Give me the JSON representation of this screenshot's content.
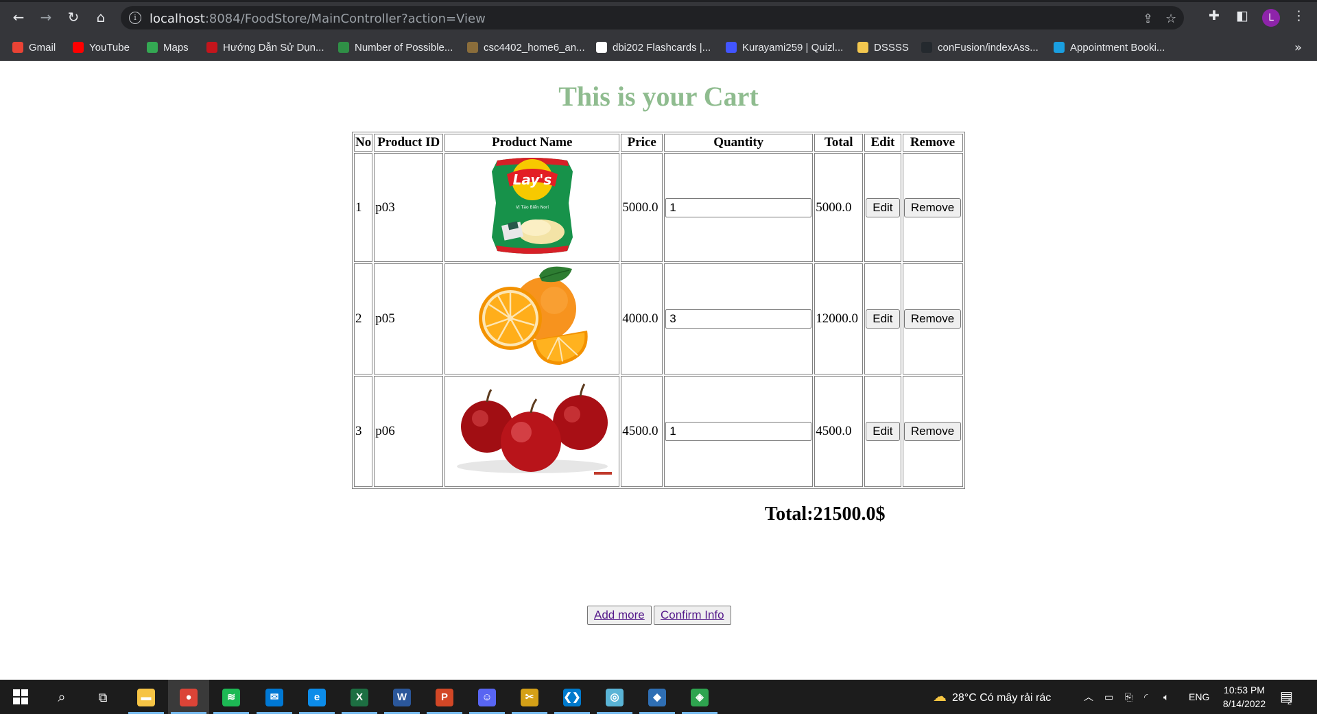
{
  "browser": {
    "url_host": "localhost",
    "url_path": ":8084/FoodStore/MainController?action=View",
    "profile_initial": "L",
    "bookmarks": [
      {
        "label": "Gmail",
        "icon": "gmail-icon",
        "color": "#ea4335"
      },
      {
        "label": "YouTube",
        "icon": "youtube-icon",
        "color": "#ff0000"
      },
      {
        "label": "Maps",
        "icon": "maps-icon",
        "color": "#34a853"
      },
      {
        "label": "Hướng Dẫn Sử Dụn...",
        "icon": "guide-icon",
        "color": "#c4151c"
      },
      {
        "label": "Number of Possible...",
        "icon": "math-icon",
        "color": "#2f8f46"
      },
      {
        "label": "csc4402_home6_an...",
        "icon": "file-icon",
        "color": "#8a6d3b"
      },
      {
        "label": "dbi202 Flashcards |...",
        "icon": "globe-icon",
        "color": "#ffffff"
      },
      {
        "label": "Kurayami259 | Quizl...",
        "icon": "quizlet-icon",
        "color": "#4255ff"
      },
      {
        "label": "DSSSS",
        "icon": "folder-icon",
        "color": "#f3c74f"
      },
      {
        "label": "conFusion/indexAss...",
        "icon": "github-icon",
        "color": "#24292e"
      },
      {
        "label": "Appointment Booki...",
        "icon": "booking-icon",
        "color": "#1a9fe0"
      }
    ]
  },
  "page": {
    "title": "This is your Cart",
    "headers": {
      "no": "No",
      "id": "Product ID",
      "name": "Product Name",
      "price": "Price",
      "quantity": "Quantity",
      "total": "Total",
      "edit": "Edit",
      "remove": "Remove"
    },
    "rows": [
      {
        "no": "1",
        "id": "p03",
        "image": "lays-chips-image",
        "price": "5000.0",
        "quantity": "1",
        "total": "5000.0",
        "edit_label": "Edit",
        "remove_label": "Remove"
      },
      {
        "no": "2",
        "id": "p05",
        "image": "orange-image",
        "price": "4000.0",
        "quantity": "3",
        "total": "12000.0",
        "edit_label": "Edit",
        "remove_label": "Remove"
      },
      {
        "no": "3",
        "id": "p06",
        "image": "apples-image",
        "price": "4500.0",
        "quantity": "1",
        "total": "4500.0",
        "edit_label": "Edit",
        "remove_label": "Remove"
      }
    ],
    "grand_total": "Total:21500.0$",
    "add_more_label": "Add more",
    "confirm_label": "Confirm Info"
  },
  "taskbar": {
    "weather": "28°C  Có mây rải rác",
    "language": "ENG",
    "time": "10:53 PM",
    "date": "8/14/2022",
    "notification_count": "2",
    "apps": [
      {
        "name": "file-explorer-icon",
        "color": "#f6c445",
        "glyph": "▬"
      },
      {
        "name": "chrome-icon",
        "color": "#db4437",
        "glyph": "●",
        "active": true
      },
      {
        "name": "spotify-icon",
        "color": "#1db954",
        "glyph": "≋"
      },
      {
        "name": "mail-icon",
        "color": "#0078d4",
        "glyph": "✉"
      },
      {
        "name": "edge-icon",
        "color": "#0c8ce9",
        "glyph": "e"
      },
      {
        "name": "excel-icon",
        "color": "#1d6f42",
        "glyph": "X"
      },
      {
        "name": "word-icon",
        "color": "#2b579a",
        "glyph": "W"
      },
      {
        "name": "powerpoint-icon",
        "color": "#d24726",
        "glyph": "P"
      },
      {
        "name": "discord-icon",
        "color": "#5865f2",
        "glyph": "☺"
      },
      {
        "name": "snip-tool-icon",
        "color": "#d4a017",
        "glyph": "✂"
      },
      {
        "name": "vscode-icon",
        "color": "#007acc",
        "glyph": "❮❯"
      },
      {
        "name": "app-icon",
        "color": "#5ab4d6",
        "glyph": "◎"
      },
      {
        "name": "virtualbox-icon",
        "color": "#2f6fb4",
        "glyph": "◆"
      },
      {
        "name": "git-icon",
        "color": "#2ea44f",
        "glyph": "◈"
      }
    ]
  }
}
